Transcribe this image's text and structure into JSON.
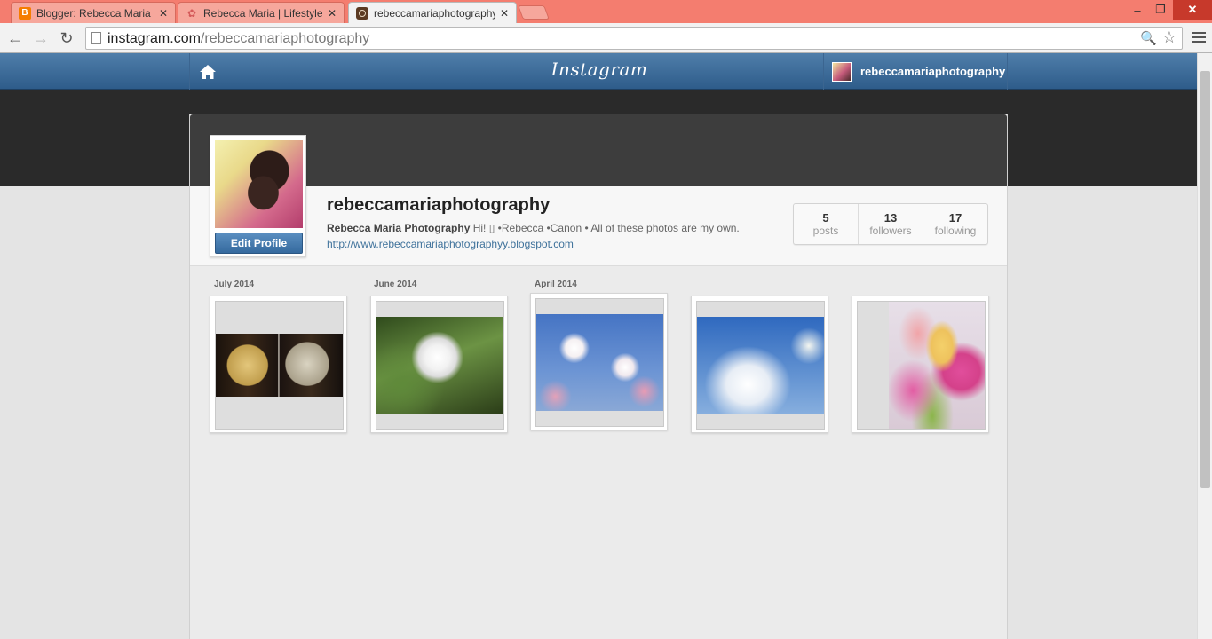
{
  "browser": {
    "tabs": [
      {
        "title": "Blogger: Rebecca Maria | L",
        "icon": "blogger-icon",
        "active": false
      },
      {
        "title": "Rebecca Maria | Lifestyle, F",
        "icon": "flower-icon",
        "active": false
      },
      {
        "title": "rebeccamariaphotography",
        "icon": "instagram-icon",
        "active": true
      }
    ],
    "close_glyph": "✕",
    "window_controls": {
      "minimize": "–",
      "restore": "❐",
      "close": "✕"
    },
    "nav": {
      "back": "←",
      "forward": "→",
      "reload": "↻"
    },
    "address": {
      "host": "instagram.com",
      "path": "/rebeccamariaphotography"
    },
    "zoom_glyph": "🔍",
    "star_glyph": "☆"
  },
  "header": {
    "logo": "Instagram",
    "username": "rebeccamariaphotography",
    "accent": "#3b6a97"
  },
  "profile": {
    "username": "rebeccamariaphotography",
    "full_name": "Rebecca Maria Photography",
    "bio": " Hi! ▯ •Rebecca •Canon • All of these photos are my own.",
    "website": "http://www.rebeccamariaphotographyy.blogspot.com",
    "edit_label": "Edit Profile",
    "stats": [
      {
        "value": "5",
        "label": "posts"
      },
      {
        "value": "13",
        "label": "followers"
      },
      {
        "value": "17",
        "label": "following"
      }
    ]
  },
  "timeline": {
    "months": [
      "July 2014",
      "June 2014",
      "April 2014"
    ],
    "photos": [
      {
        "subject": "coins"
      },
      {
        "subject": "dandelion"
      },
      {
        "subject": "blossoms"
      },
      {
        "subject": "sky"
      },
      {
        "subject": "tulips"
      }
    ]
  }
}
